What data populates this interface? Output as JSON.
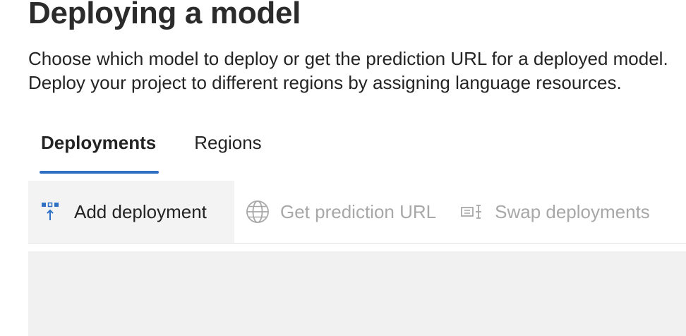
{
  "header": {
    "title": "Deploying a model",
    "description_lines": [
      "Choose which model to deploy or get the prediction URL for a deployed model.",
      "Deploy your project to different regions by assigning language resources."
    ]
  },
  "tabs": [
    {
      "label": "Deployments",
      "selected": true
    },
    {
      "label": "Regions",
      "selected": false
    }
  ],
  "toolbar": {
    "add_deployment": {
      "label": "Add deployment",
      "icon": "add-deployment-icon",
      "enabled": true
    },
    "get_prediction_url": {
      "label": "Get prediction URL",
      "icon": "globe-icon",
      "enabled": false
    },
    "swap_deployments": {
      "label": "Swap deployments",
      "icon": "swap-icon",
      "enabled": false
    }
  },
  "colors": {
    "accent": "#2f6fc4",
    "disabled_text": "#a8a8a8",
    "toolbar_hover_bg": "#f3f3f3",
    "panel_bg": "#f1f1f1"
  }
}
